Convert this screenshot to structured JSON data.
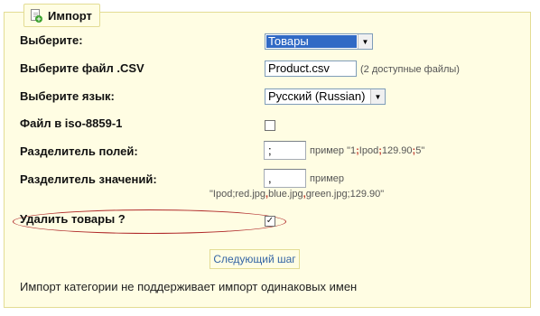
{
  "legend": {
    "title": "Импорт",
    "icon": "import-page-icon"
  },
  "rows": {
    "select_type": {
      "label": "Выберите:",
      "value": "Товары"
    },
    "csv_file": {
      "label": "Выберите файл .CSV",
      "value": "Product.csv",
      "hint": "(2 доступные файлы)"
    },
    "language": {
      "label": "Выберите язык:",
      "value": "Русский (Russian)"
    },
    "iso": {
      "label": "Файл в iso-8859-1",
      "checked": false
    },
    "field_separator": {
      "label": "Разделитель полей:",
      "value": ";",
      "hint_prefix": "пример \"1",
      "hint_sep1": ";",
      "hint_mid1": "Ipod",
      "hint_sep2": ";",
      "hint_mid2": "129.90",
      "hint_sep3": ";",
      "hint_suffix": "5\""
    },
    "value_separator": {
      "label": "Разделитель значений:",
      "value": ",",
      "hint_title": "пример",
      "example_a": "\"Ipod;red.jpg",
      "sep1": ",",
      "example_b": "blue.jpg",
      "sep2": ",",
      "example_c": "green.jpg;129.90\""
    },
    "delete_products": {
      "label": "Удалить товары ?",
      "checked": true,
      "check_glyph": "✓"
    }
  },
  "next_button": {
    "label": "Следующий шаг"
  },
  "footer": {
    "note": "Импорт категории не поддерживает импорт одинаковых имен"
  },
  "colors": {
    "panel_bg": "#fffde3",
    "panel_border": "#e3dc94",
    "select_highlight": "#316ac5",
    "annotation": "#b02a2a",
    "link": "#3465a4"
  }
}
